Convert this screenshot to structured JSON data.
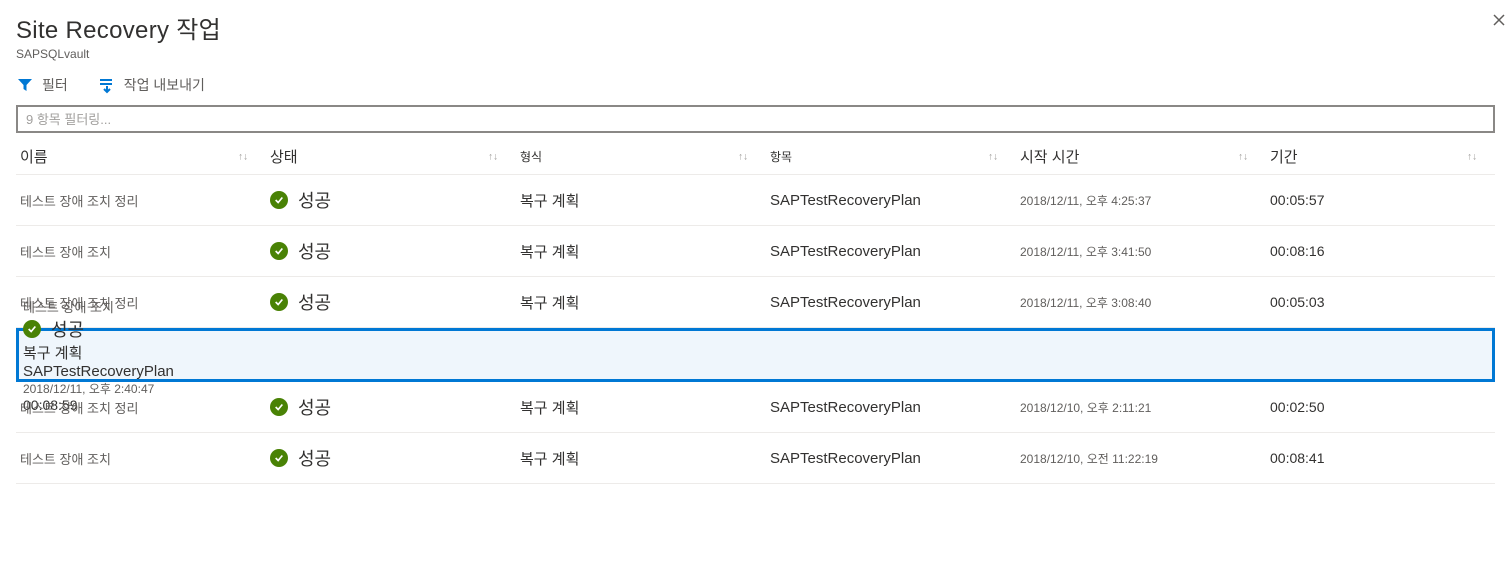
{
  "header": {
    "title": "Site Recovery 작업",
    "vault": "SAPSQLvault"
  },
  "toolbar": {
    "filter_label": "필터",
    "export_label": "작업 내보내기"
  },
  "filter_input": {
    "placeholder": "9 항목 필터링..."
  },
  "columns": {
    "name": "이름",
    "status": "상태",
    "type": "형식",
    "item": "항목",
    "start_time": "시작 시간",
    "duration": "기간"
  },
  "status_success_label": "성공",
  "rows": [
    {
      "name": "테스트 장애 조치 정리",
      "type": "복구 계획",
      "item": "SAPTestRecoveryPlan",
      "start_time": "2018/12/11, 오후 4:25:37",
      "duration": "00:05:57",
      "selected": false
    },
    {
      "name": "테스트 장애 조치",
      "type": "복구 계획",
      "item": "SAPTestRecoveryPlan",
      "start_time": "2018/12/11, 오후 3:41:50",
      "duration": "00:08:16",
      "selected": false
    },
    {
      "name": "테스트 장애 조치 정리",
      "type": "복구 계획",
      "item": "SAPTestRecoveryPlan",
      "start_time": "2018/12/11, 오후 3:08:40",
      "duration": "00:05:03",
      "selected": false
    },
    {
      "name": "테스트 장애 조치",
      "type": "복구 계획",
      "item": "SAPTestRecoveryPlan",
      "start_time": "2018/12/11, 오후 2:40:47",
      "duration": "00:08:59",
      "selected": true
    },
    {
      "name": "테스트 장애 조치 정리",
      "type": "복구 계획",
      "item": "SAPTestRecoveryPlan",
      "start_time": "2018/12/10, 오후 2:11:21",
      "duration": "00:02:50",
      "selected": false
    },
    {
      "name": "테스트 장애 조치",
      "type": "복구 계획",
      "item": "SAPTestRecoveryPlan",
      "start_time": "2018/12/10, 오전 11:22:19",
      "duration": "00:08:41",
      "selected": false
    }
  ]
}
